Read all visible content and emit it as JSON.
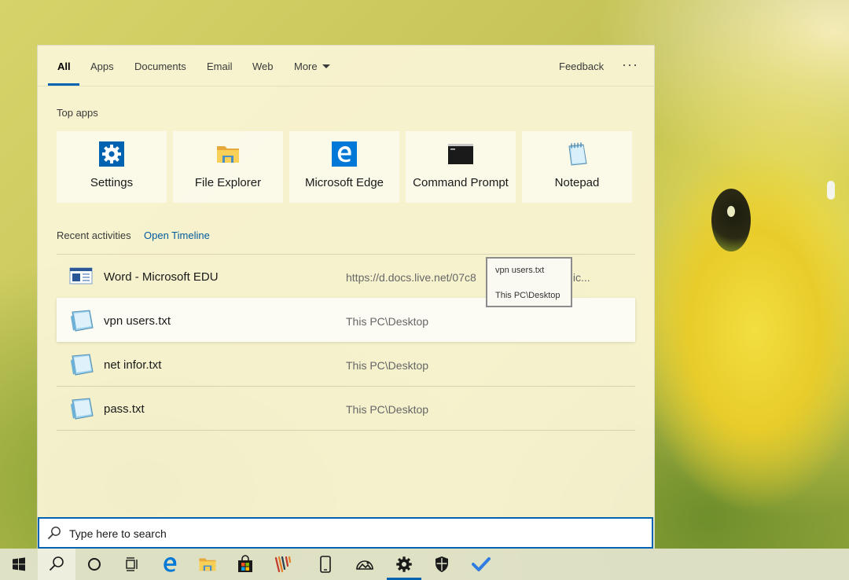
{
  "tabs": [
    {
      "label": "All"
    },
    {
      "label": "Apps"
    },
    {
      "label": "Documents"
    },
    {
      "label": "Email"
    },
    {
      "label": "Web"
    },
    {
      "label": "More"
    }
  ],
  "header": {
    "feedback_label": "Feedback",
    "more_options": "···"
  },
  "top_apps": {
    "heading": "Top apps",
    "items": [
      {
        "label": "Settings",
        "icon": "gear-icon"
      },
      {
        "label": "File Explorer",
        "icon": "folder-icon"
      },
      {
        "label": "Microsoft Edge",
        "icon": "edge-icon"
      },
      {
        "label": "Command Prompt",
        "icon": "terminal-icon"
      },
      {
        "label": "Notepad",
        "icon": "notepad-icon"
      }
    ]
  },
  "recent": {
    "heading": "Recent activities",
    "open_timeline": "Open Timeline",
    "items": [
      {
        "title": "Word - Microsoft EDU",
        "path": "https://d.docs.live.net/07c8",
        "path_tail": "IVP/Mic...",
        "icon": "word-doc-icon"
      },
      {
        "title": "vpn users.txt",
        "path": "This PC\\Desktop",
        "icon": "text-file-icon",
        "selected": true
      },
      {
        "title": "net infor.txt",
        "path": "This PC\\Desktop",
        "icon": "text-file-icon"
      },
      {
        "title": "pass.txt",
        "path": "This PC\\Desktop",
        "icon": "text-file-icon"
      }
    ]
  },
  "tooltip": {
    "line1": "vpn users.txt",
    "line2": "This PC\\Desktop"
  },
  "search": {
    "placeholder": "Type here to search"
  },
  "taskbar": [
    {
      "icon": "windows-start-icon"
    },
    {
      "icon": "search-icon",
      "active": true
    },
    {
      "icon": "cortana-icon"
    },
    {
      "icon": "task-view-icon"
    },
    {
      "icon": "edge-icon"
    },
    {
      "icon": "file-explorer-icon"
    },
    {
      "icon": "store-icon"
    },
    {
      "icon": "pen-app-icon"
    },
    {
      "icon": "phone-icon"
    },
    {
      "icon": "photos-icon"
    },
    {
      "icon": "settings-icon",
      "running": true
    },
    {
      "icon": "security-shield-icon"
    },
    {
      "icon": "todo-check-icon"
    }
  ],
  "colors": {
    "accent": "#0063b1",
    "link": "#005a9e",
    "panel": "#faf5d6"
  }
}
